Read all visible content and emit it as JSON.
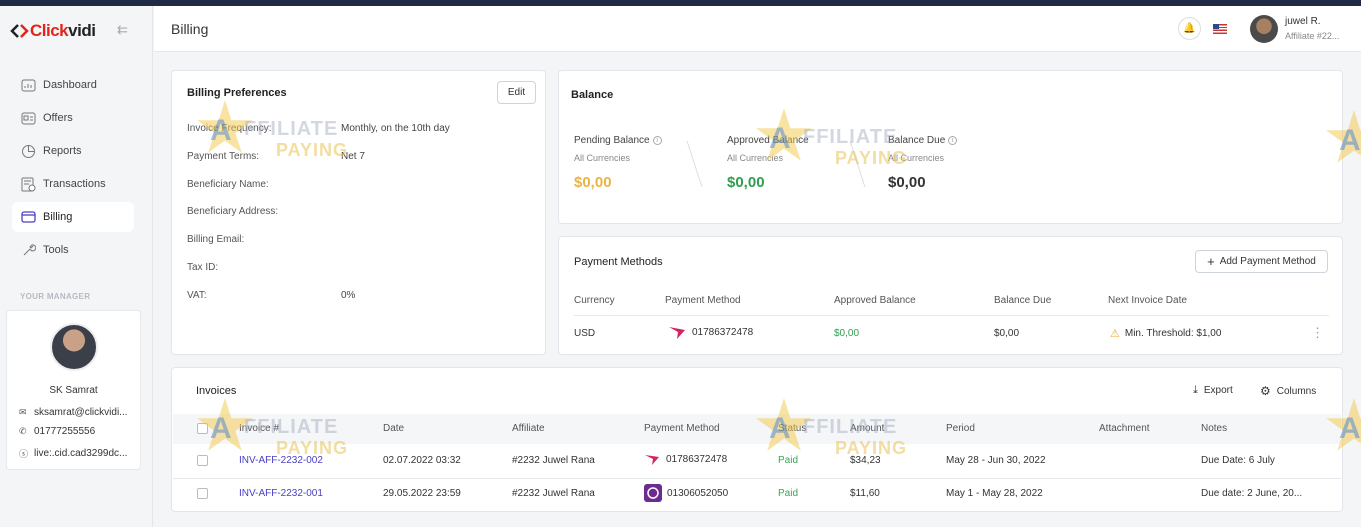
{
  "brand": {
    "logo_red": "Click",
    "logo_dark": "vidi",
    "accent": "#e1251b"
  },
  "sidebar": {
    "items": [
      {
        "label": "Dashboard",
        "icon": "dashboard-icon"
      },
      {
        "label": "Offers",
        "icon": "offers-icon"
      },
      {
        "label": "Reports",
        "icon": "reports-icon"
      },
      {
        "label": "Transactions",
        "icon": "transactions-icon"
      },
      {
        "label": "Billing",
        "icon": "billing-icon",
        "active": true
      },
      {
        "label": "Tools",
        "icon": "tools-icon"
      }
    ],
    "manager_label": "YOUR MANAGER",
    "manager": {
      "name": "SK Samrat",
      "email": "sksamrat@clickvidi...",
      "phone": "01777255556",
      "skype": "live:.cid.cad3299dc..."
    }
  },
  "header": {
    "title": "Billing",
    "user_name": "juwel R.",
    "user_sub": "Affiliate #22..."
  },
  "preferences": {
    "title": "Billing Preferences",
    "edit_label": "Edit",
    "rows": [
      {
        "label": "Invoice Frequency:",
        "value": "Monthly, on the 10th day"
      },
      {
        "label": "Payment Terms:",
        "value": "Net 7"
      },
      {
        "label": "Beneficiary Name:",
        "value": ""
      },
      {
        "label": "Beneficiary Address:",
        "value": ""
      },
      {
        "label": "Billing Email:",
        "value": ""
      },
      {
        "label": "Tax ID:",
        "value": ""
      },
      {
        "label": "VAT:",
        "value": "0%"
      }
    ]
  },
  "balance": {
    "title": "Balance",
    "pending": {
      "label": "Pending Balance",
      "sub": "All Currencies",
      "value": "$0,00",
      "color": "#e8b544"
    },
    "approved": {
      "label": "Approved Balance",
      "sub": "All Currencies",
      "value": "$0,00",
      "color": "#2f9e4f"
    },
    "due": {
      "label": "Balance Due",
      "sub": "All Currencies",
      "value": "$0,00",
      "color": "#333333"
    }
  },
  "payment_methods": {
    "title": "Payment Methods",
    "add_label": "Add Payment Method",
    "columns": [
      "Currency",
      "Payment Method",
      "Approved Balance",
      "Balance Due",
      "Next Invoice Date"
    ],
    "row": {
      "currency": "USD",
      "method": "01786372478",
      "approved": "$0,00",
      "due": "$0,00",
      "next": "Min. Threshold: $1,00"
    }
  },
  "invoices": {
    "title": "Invoices",
    "export_label": "Export",
    "columns_label": "Columns",
    "columns": [
      "Invoice #",
      "Date",
      "Affiliate",
      "Payment Method",
      "Status",
      "Amount",
      "Period",
      "Attachment",
      "Notes"
    ],
    "rows": [
      {
        "invoice": "INV-AFF-2232-002",
        "date": "02.07.2022 03:32",
        "affiliate": "#2232 Juwel Rana",
        "method": "01786372478",
        "status": "Paid",
        "amount": "$34,23",
        "period": "May 28 - Jun 30, 2022",
        "attachment": "",
        "notes": "Due Date: 6 July"
      },
      {
        "invoice": "INV-AFF-2232-001",
        "date": "29.05.2022 23:59",
        "affiliate": "#2232 Juwel Rana",
        "method": "01306052050",
        "status": "Paid",
        "amount": "$11,60",
        "period": "May 1 - May 28, 2022",
        "attachment": "",
        "notes": "Due date: 2 June, 20..."
      }
    ]
  },
  "watermark": {
    "letter": "A",
    "line1": "FFILIATE",
    "line2": "PAYING"
  }
}
